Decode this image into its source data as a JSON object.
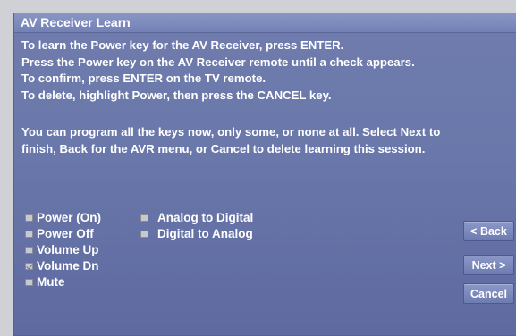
{
  "window": {
    "title": "AV Receiver Learn"
  },
  "instructions": [
    "To learn the Power key for the AV Receiver, press ENTER.",
    "Press the Power key on the AV Receiver remote until a check appears.",
    "To confirm, press ENTER on the TV remote.",
    "To delete, highlight Power, then press the CANCEL key."
  ],
  "info": [
    "You can program all the keys now, only some, or none at all. Select Next to",
    "finish, Back for the AVR menu, or Cancel to delete learning this session."
  ],
  "keys_left": [
    {
      "label": "Power (On)",
      "checked": false,
      "highlighted": true
    },
    {
      "label": "Power Off",
      "checked": false,
      "highlighted": false
    },
    {
      "label": "Volume Up",
      "checked": false,
      "highlighted": false
    },
    {
      "label": "Volume Dn",
      "checked": true,
      "highlighted": false
    },
    {
      "label": "Mute",
      "checked": false,
      "highlighted": false
    }
  ],
  "keys_right": [
    {
      "label": "Analog to Digital",
      "checked": false
    },
    {
      "label": "Digital to Analog",
      "checked": false
    }
  ],
  "buttons": {
    "back": "< Back",
    "next": "Next >",
    "cancel": "Cancel"
  },
  "colors": {
    "background": "#6a77aa",
    "titlebar": "#7381b5",
    "text": "#ffffff",
    "button": "#7b88bb"
  }
}
